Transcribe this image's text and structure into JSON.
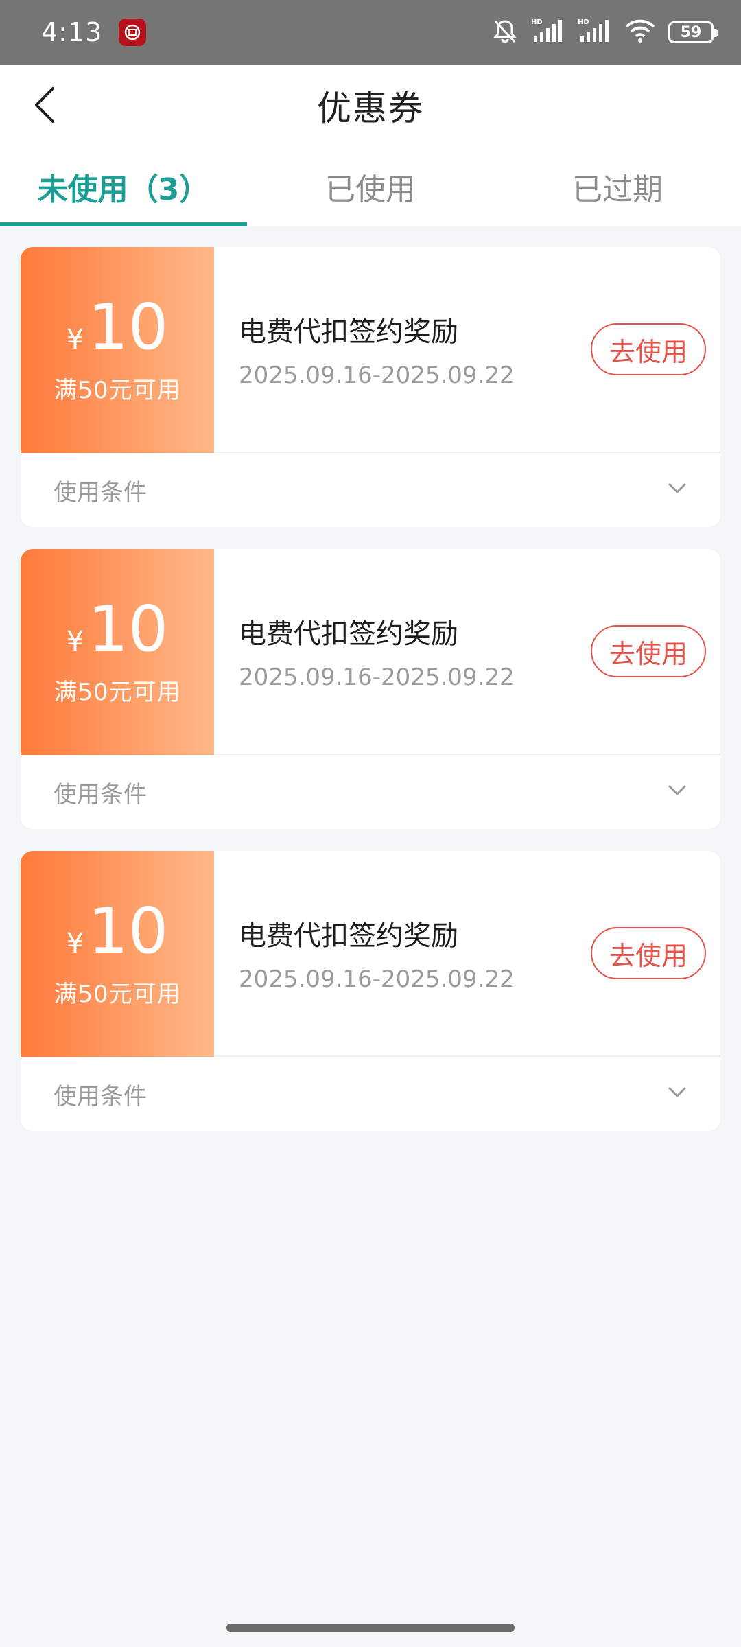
{
  "status_bar": {
    "time": "4:13",
    "battery": "59",
    "icons": [
      "mute-bell-icon",
      "hd-signal-icon",
      "hd-signal-icon",
      "wifi-icon",
      "battery-icon"
    ]
  },
  "header": {
    "title": "优惠券",
    "back_icon": "chevron-left-icon"
  },
  "tabs": [
    {
      "label": "未使用（3）",
      "active": true
    },
    {
      "label": "已使用",
      "active": false
    },
    {
      "label": "已过期",
      "active": false
    }
  ],
  "coupons": [
    {
      "currency": "¥",
      "amount": "10",
      "condition": "满50元可用",
      "name": "电费代扣签约奖励",
      "date_range": "2025.09.16-2025.09.22",
      "action": "去使用",
      "terms_label": "使用条件"
    },
    {
      "currency": "¥",
      "amount": "10",
      "condition": "满50元可用",
      "name": "电费代扣签约奖励",
      "date_range": "2025.09.16-2025.09.22",
      "action": "去使用",
      "terms_label": "使用条件"
    },
    {
      "currency": "¥",
      "amount": "10",
      "condition": "满50元可用",
      "name": "电费代扣签约奖励",
      "date_range": "2025.09.16-2025.09.22",
      "action": "去使用",
      "terms_label": "使用条件"
    }
  ],
  "colors": {
    "accent": "#1e9c96",
    "action": "#e4534a",
    "coupon_gradient_start": "#ff7a3a",
    "coupon_gradient_end": "#ffb98a"
  }
}
